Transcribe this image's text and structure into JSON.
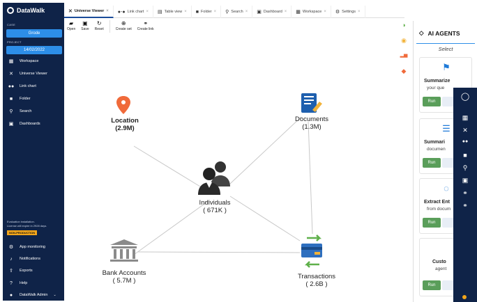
{
  "sidebar": {
    "app_name": "DataWalk",
    "case_label": "CASE",
    "case_value": "Grode",
    "project_label": "PROJECT",
    "project_value": "14/02/2022",
    "nav": [
      {
        "label": "Workspace",
        "icon": "grid-icon"
      },
      {
        "label": "Universe Viewer",
        "icon": "universe-icon"
      },
      {
        "label": "Link chart",
        "icon": "link-chart-icon"
      },
      {
        "label": "Folder",
        "icon": "folder-icon"
      },
      {
        "label": "Search",
        "icon": "search-icon"
      },
      {
        "label": "Dashboards",
        "icon": "dashboard-icon"
      }
    ],
    "eval_line1": "Evaluation installation.",
    "eval_line2": "License will expire in 2928 days.",
    "badge": "NON-PRODUCTION",
    "bottom": [
      {
        "label": "App monitoring",
        "icon": "gear-icon"
      },
      {
        "label": "Notifications",
        "icon": "bell-icon"
      },
      {
        "label": "Exports",
        "icon": "export-icon"
      },
      {
        "label": "Help",
        "icon": "help-icon"
      },
      {
        "label": "DataWalk Admin",
        "icon": "user-icon"
      }
    ]
  },
  "tabs": [
    {
      "label": "Universe Viewer",
      "active": true
    },
    {
      "label": "Link chart",
      "active": false
    },
    {
      "label": "Table view",
      "active": false
    },
    {
      "label": "Folder",
      "active": false
    },
    {
      "label": "Search",
      "active": false
    },
    {
      "label": "Dashboard",
      "active": false
    },
    {
      "label": "Workspace",
      "active": false
    },
    {
      "label": "Settings",
      "active": false
    }
  ],
  "toolbar": {
    "open": "Open",
    "save": "Save",
    "reset": "Reset",
    "create_set": "Create set",
    "create_link": "Create link"
  },
  "graph": {
    "location": {
      "name": "Location",
      "count": "(2.9M)"
    },
    "documents": {
      "name": "Documents",
      "count": "(1.3M)"
    },
    "individuals": {
      "name": "Individuals",
      "count": "( 671K )"
    },
    "bank_accounts": {
      "name": "Bank Accounts",
      "count": "( 5.7M )"
    },
    "transactions": {
      "name": "Transactions",
      "count": "( 2.6B )"
    }
  },
  "ai_panel": {
    "title": "AI AGENTS",
    "select": "Select",
    "cards": [
      {
        "title": "Summarize",
        "subtitle": "your que",
        "run": "Run"
      },
      {
        "title": "Summari",
        "subtitle": "documen",
        "run": "Run"
      },
      {
        "title": "Extract Ent",
        "subtitle": "from docum",
        "run": "Run"
      },
      {
        "title": "Custo",
        "subtitle": "agent",
        "run": "Run"
      }
    ]
  },
  "colors": {
    "sidebar_bg": "#0f2348",
    "accent": "#2d8ee8",
    "run_green": "#5a9e5a",
    "badge": "#f2a51a",
    "location_pin": "#f06a3a"
  }
}
